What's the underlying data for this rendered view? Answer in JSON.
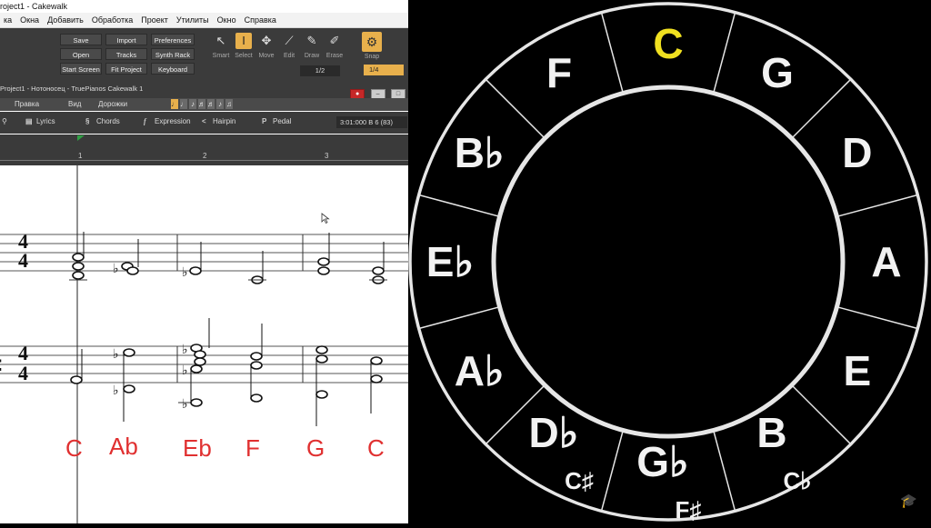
{
  "window": {
    "title": "roject1 - Cakewalk"
  },
  "menu": [
    "ка",
    "Окна",
    "Добавить",
    "Обработка",
    "Проект",
    "Утилиты",
    "Окно",
    "Справка"
  ],
  "controlbar": {
    "buttons": [
      [
        "Save",
        "Import",
        "Preferences"
      ],
      [
        "Open",
        "Tracks",
        "Synth Rack"
      ],
      [
        "Start Screen",
        "Fit Project",
        "Keyboard"
      ]
    ],
    "tools": [
      "Smart",
      "Select",
      "Move",
      "Edit",
      "Draw",
      "Erase"
    ],
    "active_tool": "Select",
    "snap_label": "Snap",
    "snap_value": "1/4",
    "draw_value": "1/2"
  },
  "document": {
    "title": "Project1 - Нотоносец - TruePianos Cakewalk 1"
  },
  "view_menu": [
    "Правка",
    "Вид",
    "Дорожки"
  ],
  "notation_tools": [
    "Lyrics",
    "Chords",
    "Expression",
    "Hairpin",
    "Pedal"
  ],
  "position_readout": "3:01:000  B 6 (83)",
  "ruler": [
    "1",
    "2",
    "3"
  ],
  "time_signature": {
    "top": "4",
    "bottom": "4"
  },
  "chords": [
    "C",
    "Ab",
    "Eb",
    "F",
    "G",
    "C"
  ],
  "circle_of_fifths": {
    "highlight_color": "#f0e020",
    "text_color": "#f2f2f2",
    "ring_color": "#e6e6e6",
    "highlighted": "C",
    "keys": [
      {
        "main": "C"
      },
      {
        "main": "G"
      },
      {
        "main": "D"
      },
      {
        "main": "A"
      },
      {
        "main": "E"
      },
      {
        "main": "B",
        "alt": "C♭"
      },
      {
        "main": "G♭",
        "alt": "F♯"
      },
      {
        "main": "D♭",
        "alt": "C♯"
      },
      {
        "main": "A♭"
      },
      {
        "main": "E♭"
      },
      {
        "main": "B♭"
      },
      {
        "main": "F"
      }
    ]
  },
  "icons": {
    "corner": "graduation-cap-icon"
  }
}
